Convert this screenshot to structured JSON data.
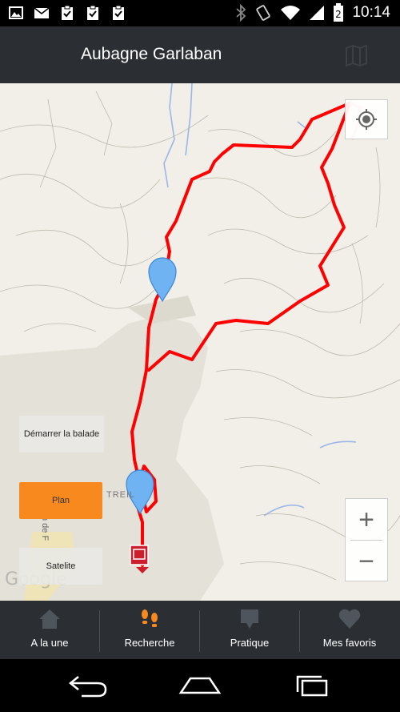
{
  "status_bar": {
    "time": "10:14",
    "left_icons": [
      "image-icon",
      "mail-icon",
      "clipboard-check-icon",
      "clipboard-check-icon",
      "clipboard-check-icon"
    ],
    "right_icons": [
      "bluetooth-icon",
      "vibrate-icon",
      "wifi-icon",
      "signal-icon",
      "battery-icon"
    ]
  },
  "app_bar": {
    "title": "Aubagne Garlaban",
    "map_toggle_icon": "map-icon"
  },
  "map": {
    "place_label": "TREIL",
    "road_label": "n de F",
    "watermark": "Google",
    "route_color": "#ff0000",
    "start_button": "Démarrer la balade",
    "plan_button": "Plan",
    "satellite_button": "Satelite",
    "zoom_in": "+",
    "zoom_out": "−",
    "my_location_icon": "my-location-icon"
  },
  "tab_bar": {
    "active_color": "#f7891e",
    "tabs": [
      {
        "label": "A la une",
        "icon": "home-icon"
      },
      {
        "label": "Recherche",
        "icon": "footprints-icon"
      },
      {
        "label": "Pratique",
        "icon": "speech-bubble-icon"
      },
      {
        "label": "Mes favoris",
        "icon": "heart-icon"
      }
    ]
  },
  "nav_bar": {
    "icons": [
      "back-icon",
      "home-icon",
      "recent-apps-icon"
    ]
  }
}
